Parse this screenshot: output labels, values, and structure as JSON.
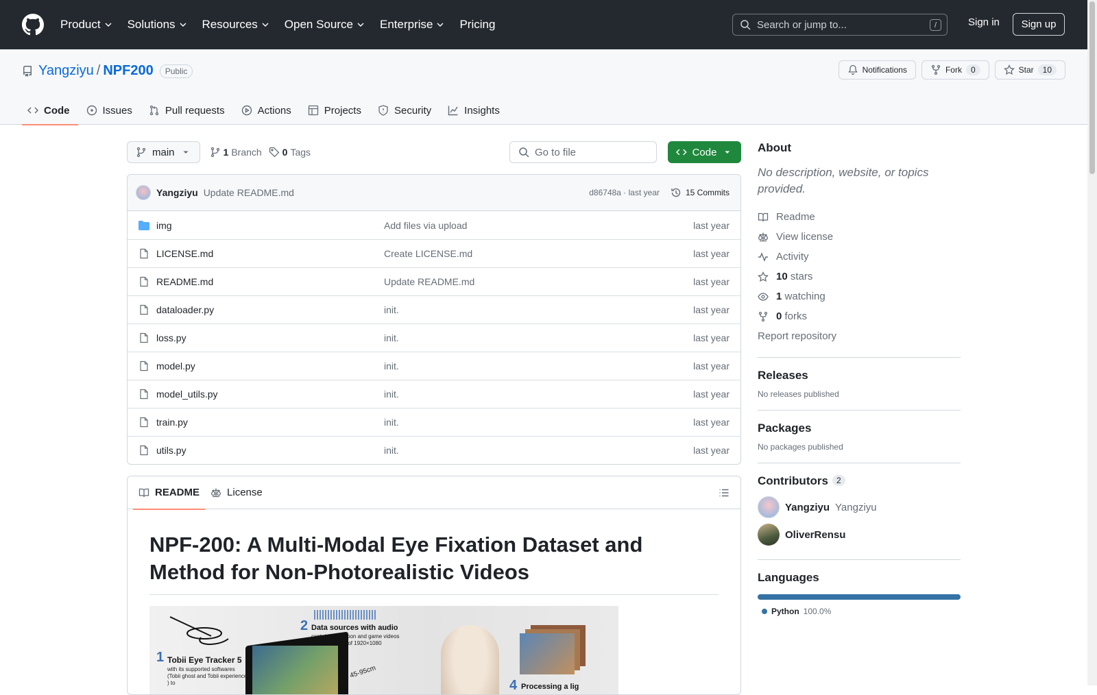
{
  "header": {
    "nav": [
      "Product",
      "Solutions",
      "Resources",
      "Open Source",
      "Enterprise",
      "Pricing"
    ],
    "search_placeholder": "Search or jump to...",
    "search_hint": "/",
    "signin": "Sign in",
    "signup": "Sign up"
  },
  "repo": {
    "owner": "Yangziyu",
    "separator": "/",
    "name": "NPF200",
    "visibility": "Public",
    "notifications": "Notifications",
    "fork_label": "Fork",
    "fork_count": "0",
    "star_label": "Star",
    "star_count": "10"
  },
  "tabs": [
    "Code",
    "Issues",
    "Pull requests",
    "Actions",
    "Projects",
    "Security",
    "Insights"
  ],
  "toolbar": {
    "branch": "main",
    "branches_count": "1",
    "branches_label": "Branch",
    "tags_count": "0",
    "tags_label": "Tags",
    "goto_placeholder": "Go to file",
    "code_button": "Code"
  },
  "commit": {
    "author": "Yangziyu",
    "message": "Update README.md",
    "sha_time": "d86748a · last year",
    "commits": "15 Commits"
  },
  "files": [
    {
      "name": "img",
      "type": "dir",
      "message": "Add files via upload",
      "time": "last year"
    },
    {
      "name": "LICENSE.md",
      "type": "file",
      "message": "Create LICENSE.md",
      "time": "last year"
    },
    {
      "name": "README.md",
      "type": "file",
      "message": "Update README.md",
      "time": "last year"
    },
    {
      "name": "dataloader.py",
      "type": "file",
      "message": "init.",
      "time": "last year"
    },
    {
      "name": "loss.py",
      "type": "file",
      "message": "init.",
      "time": "last year"
    },
    {
      "name": "model.py",
      "type": "file",
      "message": "init.",
      "time": "last year"
    },
    {
      "name": "model_utils.py",
      "type": "file",
      "message": "init.",
      "time": "last year"
    },
    {
      "name": "train.py",
      "type": "file",
      "message": "init.",
      "time": "last year"
    },
    {
      "name": "utils.py",
      "type": "file",
      "message": "init.",
      "time": "last year"
    }
  ],
  "readme": {
    "tab_readme": "README",
    "tab_license": "License",
    "title": "NPF-200: A Multi-Modal Eye Fixation Dataset and Method for Non-Photorealistic Videos",
    "figure": {
      "n1": "1",
      "l1": "Tobii Eye Tracker 5",
      "s1": "with its supported softwares (Tobii ghost and Tobii experience ) to",
      "n2": "2",
      "l2": "Data sources with audio",
      "s2": "containing cartoon and game videos with resolution of 1920×1080",
      "dist": "45-95cm",
      "n4": "4",
      "l4": "Processing a lig"
    }
  },
  "sidebar": {
    "about_title": "About",
    "about_desc": "No description, website, or topics provided.",
    "links": {
      "readme": "Readme",
      "license": "View license",
      "activity": "Activity",
      "stars_n": "10",
      "stars": "stars",
      "watch_n": "1",
      "watch": "watching",
      "forks_n": "0",
      "forks": "forks",
      "report": "Report repository"
    },
    "releases_title": "Releases",
    "releases_text": "No releases published",
    "packages_title": "Packages",
    "packages_text": "No packages published",
    "contributors_title": "Contributors",
    "contributors_count": "2",
    "contributors": [
      {
        "name": "Yangziyu",
        "login": "Yangziyu"
      },
      {
        "name": "OliverRensu",
        "login": ""
      }
    ],
    "languages_title": "Languages",
    "language": "Python",
    "language_pct": "100.0%",
    "language_color": "#3572a5"
  }
}
